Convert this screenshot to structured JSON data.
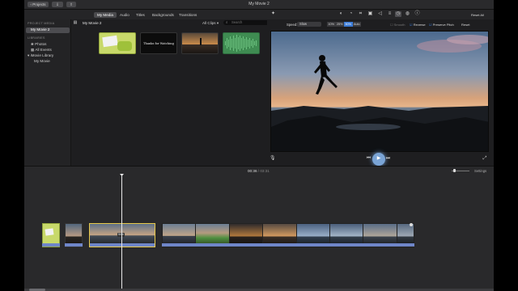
{
  "titlebar": {
    "projects_label": "Projects",
    "window_title": "My Movie 2"
  },
  "tabs": [
    {
      "label": "My Media"
    },
    {
      "label": "Audio"
    },
    {
      "label": "Titles"
    },
    {
      "label": "Backgrounds"
    },
    {
      "label": "Transitions"
    }
  ],
  "sidebar": {
    "project_media_header": "PROJECT MEDIA",
    "project_item": "My Movie 2",
    "libraries_header": "LIBRARIES",
    "items": [
      {
        "label": "Photos"
      },
      {
        "label": "All Events"
      },
      {
        "label": "iMovie Library"
      },
      {
        "label": "My Movie"
      }
    ]
  },
  "browser": {
    "heading": "My Movie 2",
    "filter": "All Clips",
    "search_placeholder": "Search",
    "clip2_text": "Thanks for Watching"
  },
  "viewer_toolbar": {
    "reset_all": "Reset All",
    "speed_label": "Speed:",
    "speed_value": "Slow",
    "speed_options": [
      "10%",
      "25%",
      "50%",
      "Auto"
    ],
    "selected_speed": "50%",
    "smooth": "Smooth",
    "reverse": "Reverse",
    "preserve_pitch": "Preserve Pitch",
    "reset": "Reset"
  },
  "timeline": {
    "current_time": "00:36",
    "total_time": "03:31",
    "settings": "Settings",
    "clip_badge": "50%"
  },
  "colors": {
    "accent_blue": "#3b7bd6",
    "clip_selected_border": "#e6c84a",
    "audio_blue": "#6f86c9"
  },
  "icons": [
    "speed-icon",
    "crop-icon",
    "color-icon",
    "search-icon",
    "mic-icon",
    "play-icon",
    "fullscreen-icon"
  ]
}
